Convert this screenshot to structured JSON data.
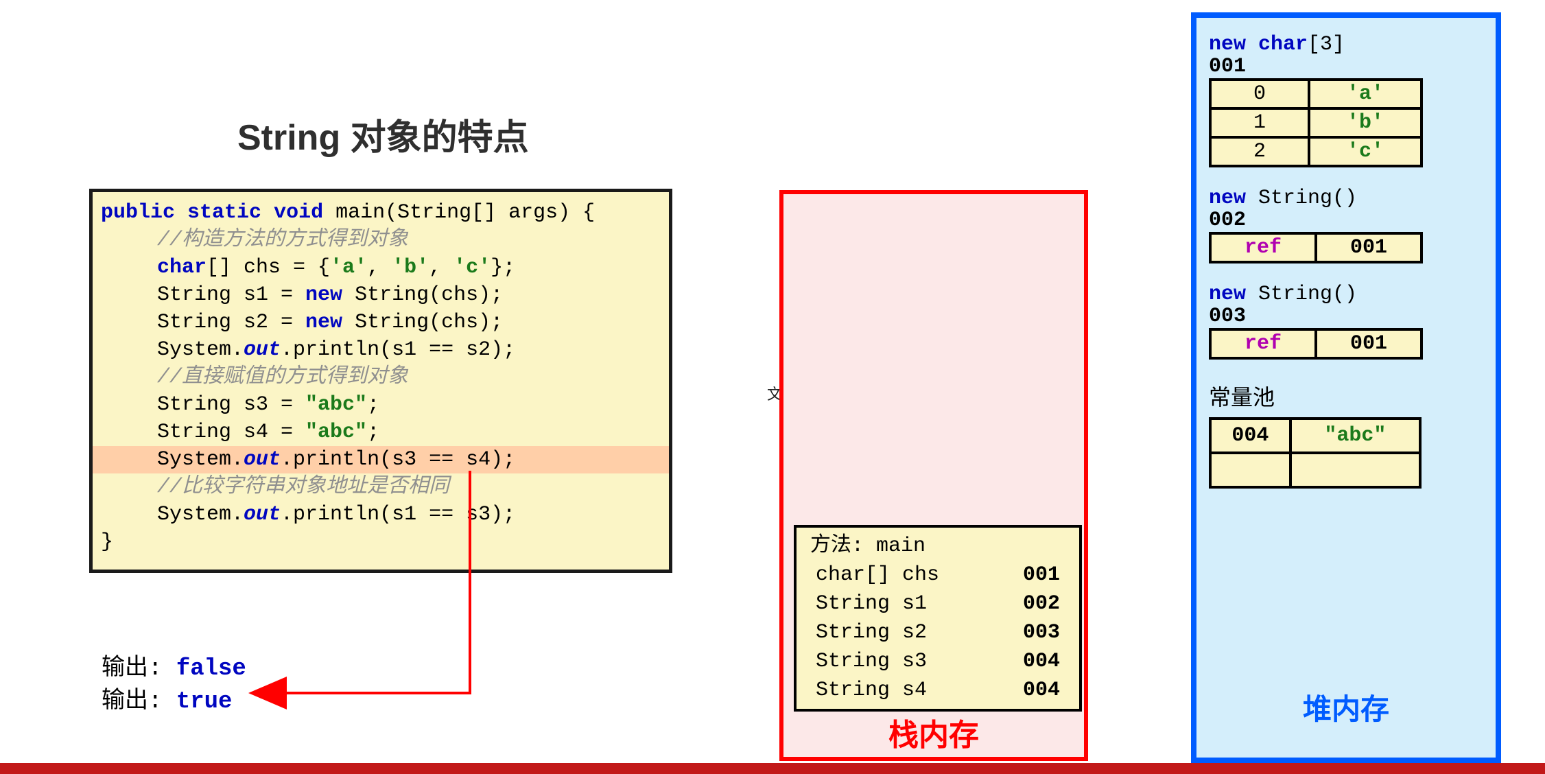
{
  "title": "String 对象的特点",
  "code": {
    "l1_public": "public",
    "l1_static": "static",
    "l1_void": "void",
    "l1_rest": " main(String[] args) {",
    "c1": "//构造方法的方式得到对象",
    "l3a": "char",
    "l3b": "[] chs = {",
    "l3c1": "'a'",
    "l3sep": ", ",
    "l3c2": "'b'",
    "l3c3": "'c'",
    "l3end": "};",
    "l4a": "String s1 = ",
    "l4new": "new",
    "l4b": " String(chs);",
    "l5a": "String s2 = ",
    "l5new": "new",
    "l5b": " String(chs);",
    "l6a": "System.",
    "l6out": "out",
    "l6b": ".println(s1 == s2);",
    "c2": "//直接赋值的方式得到对象",
    "l8a": "String s3 = ",
    "l8s": "\"abc\"",
    "l8e": ";",
    "l9a": "String s4 = ",
    "l9s": "\"abc\"",
    "l9e": ";",
    "l10a": "System.",
    "l10out": "out",
    "l10b": ".println(s3 == s4);",
    "c3": "//比较字符串对象地址是否相同",
    "l12a": "System.",
    "l12out": "out",
    "l12b": ".println(s1 == s3);",
    "lend": "}"
  },
  "output1_label": "输出: ",
  "output1_val": "false",
  "output2_label": "输出: ",
  "output2_val": "true",
  "stray": "文本",
  "stack": {
    "title": "栈内存",
    "head": "方法: main",
    "rows": [
      {
        "t": "char[]  chs",
        "a": "001"
      },
      {
        "t": "String  s1",
        "a": "002"
      },
      {
        "t": "String  s2",
        "a": "003"
      },
      {
        "t": "String  s3",
        "a": "004"
      },
      {
        "t": "String  s4",
        "a": "004"
      }
    ]
  },
  "heap": {
    "title": "堆内存",
    "chararr": {
      "decl_new": "new",
      "decl_type": " char",
      "decl_dim": "[3]",
      "addr": "001",
      "rows": [
        {
          "i": "0",
          "v": "'a'"
        },
        {
          "i": "1",
          "v": "'b'"
        },
        {
          "i": "2",
          "v": "'c'"
        }
      ]
    },
    "str1": {
      "decl_new": "new",
      "decl_type": " String()",
      "addr": "002",
      "ref_label": "ref",
      "ref_val": "001"
    },
    "str2": {
      "decl_new": "new",
      "decl_type": " String()",
      "addr": "003",
      "ref_label": "ref",
      "ref_val": "001"
    },
    "pool": {
      "title": "常量池",
      "rows": [
        {
          "a": "004",
          "v": "\"abc\""
        }
      ]
    }
  }
}
